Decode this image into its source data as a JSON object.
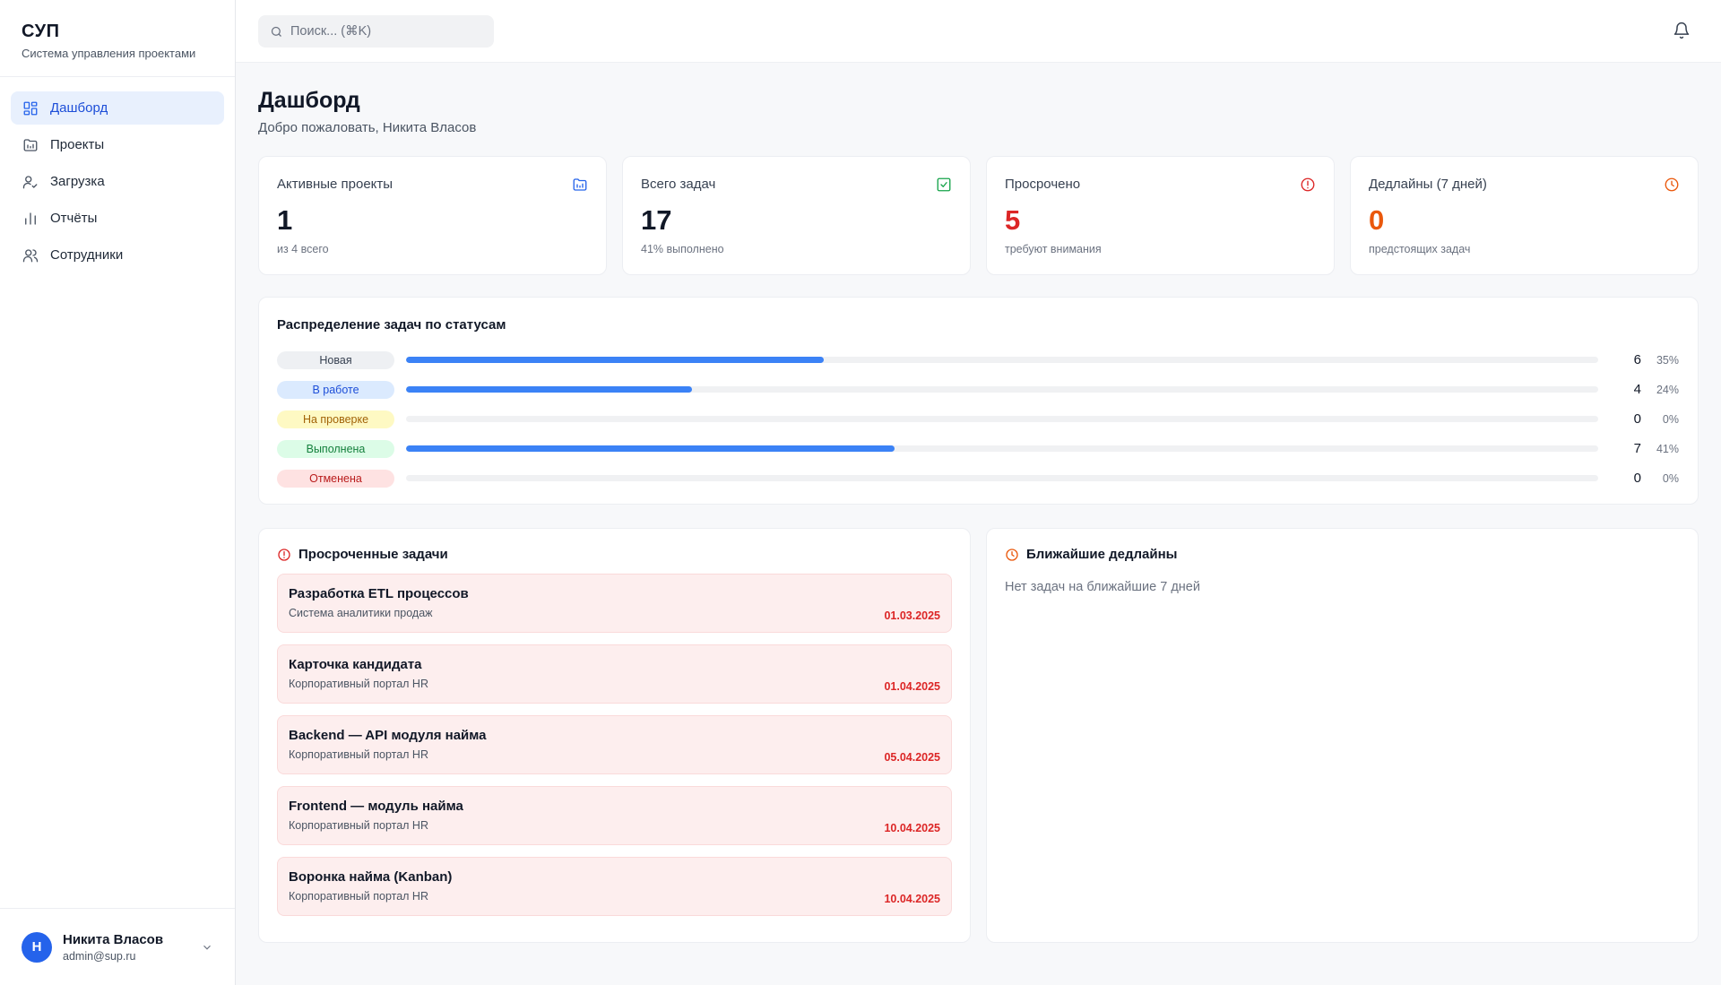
{
  "brand": {
    "title": "СУП",
    "subtitle": "Система управления проектами"
  },
  "sidebar": {
    "items": [
      {
        "label": "Дашборд",
        "icon": "dashboard-icon",
        "active": true
      },
      {
        "label": "Проекты",
        "icon": "folder-icon",
        "active": false
      },
      {
        "label": "Загрузка",
        "icon": "user-check-icon",
        "active": false
      },
      {
        "label": "Отчёты",
        "icon": "bar-chart-icon",
        "active": false
      },
      {
        "label": "Сотрудники",
        "icon": "users-icon",
        "active": false
      }
    ]
  },
  "user": {
    "initial": "Н",
    "name": "Никита Власов",
    "email": "admin@sup.ru"
  },
  "search": {
    "placeholder": "Поиск... (⌘K)"
  },
  "page": {
    "title": "Дашборд",
    "subtitle": "Добро пожаловать, Никита Власов"
  },
  "stats": [
    {
      "label": "Активные проекты",
      "value": "1",
      "note": "из 4 всего",
      "icon": "folder-icon",
      "icon_color": "#2563eb"
    },
    {
      "label": "Всего задач",
      "value": "17",
      "note": "41% выполнено",
      "icon": "check-square-icon",
      "icon_color": "#16a34a"
    },
    {
      "label": "Просрочено",
      "value": "5",
      "note": "требуют внимания",
      "icon": "alert-circle-icon",
      "icon_color": "#dc2626"
    },
    {
      "label": "Дедлайны (7 дней)",
      "value": "0",
      "note": "предстоящих задач",
      "icon": "clock-icon",
      "icon_color": "#ea580c"
    }
  ],
  "status_distribution": {
    "title": "Распределение задач по статусам",
    "rows": [
      {
        "label": "Новая",
        "count": "6",
        "percent": "35%",
        "fraction": 0.35,
        "pill_bg": "#eef0f3",
        "pill_fg": "#374151"
      },
      {
        "label": "В работе",
        "count": "4",
        "percent": "24%",
        "fraction": 0.24,
        "pill_bg": "#dbeafe",
        "pill_fg": "#1d4ed8"
      },
      {
        "label": "На проверке",
        "count": "0",
        "percent": "0%",
        "fraction": 0,
        "pill_bg": "#fef9c3",
        "pill_fg": "#a16207"
      },
      {
        "label": "Выполнена",
        "count": "7",
        "percent": "41%",
        "fraction": 0.41,
        "pill_bg": "#dcfce7",
        "pill_fg": "#15803d"
      },
      {
        "label": "Отменена",
        "count": "0",
        "percent": "0%",
        "fraction": 0,
        "pill_bg": "#fee2e2",
        "pill_fg": "#b91c1c"
      }
    ]
  },
  "overdue": {
    "title": "Просроченные задачи",
    "tasks": [
      {
        "name": "Разработка ETL процессов",
        "project": "Система аналитики продаж",
        "date": "01.03.2025"
      },
      {
        "name": "Карточка кандидата",
        "project": "Корпоративный портал HR",
        "date": "01.04.2025"
      },
      {
        "name": "Backend — API модуля найма",
        "project": "Корпоративный портал HR",
        "date": "05.04.2025"
      },
      {
        "name": "Frontend — модуль найма",
        "project": "Корпоративный портал HR",
        "date": "10.04.2025"
      },
      {
        "name": "Воронка найма (Kanban)",
        "project": "Корпоративный портал HR",
        "date": "10.04.2025"
      }
    ]
  },
  "deadlines": {
    "title": "Ближайшие дедлайны",
    "empty_text": "Нет задач на ближайшие 7 дней"
  },
  "colors": {
    "accent": "#2563eb",
    "danger": "#dc2626",
    "warning": "#ea580c",
    "success": "#16a34a"
  }
}
